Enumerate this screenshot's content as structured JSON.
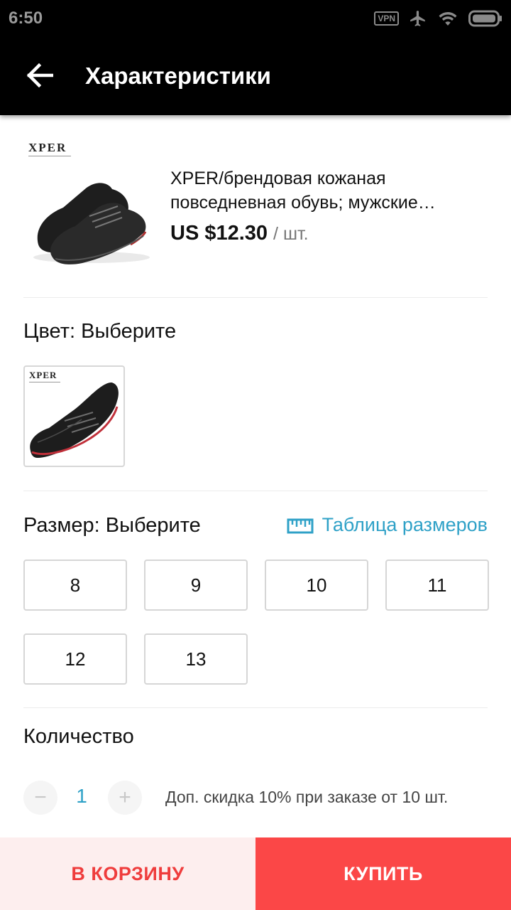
{
  "status_bar": {
    "time": "6:50",
    "vpn_label": "VPN",
    "icons": [
      "vpn-icon",
      "airplane-icon",
      "wifi-icon",
      "battery-icon"
    ]
  },
  "app_bar": {
    "title": "Характеристики",
    "back_icon": "arrow-left-icon"
  },
  "product": {
    "brand_logo": "XPER",
    "title": "XPER/брендовая кожаная повседневная обувь; мужские мокасины",
    "price": "US $12.30",
    "unit": "/ шт."
  },
  "color": {
    "label": "Цвет: Выберите",
    "options": [
      {
        "logo": "XPER",
        "selected": false
      }
    ]
  },
  "size": {
    "label": "Размер: Выберите",
    "table_link": "Таблица размеров",
    "options": [
      "8",
      "9",
      "10",
      "11",
      "12",
      "13"
    ]
  },
  "quantity": {
    "label": "Количество",
    "minus": "−",
    "plus": "+",
    "value": "1",
    "discount_note": "Доп. скидка 10% при заказе от 10 шт."
  },
  "actions": {
    "add_to_cart": "В КОРЗИНУ",
    "buy": "КУПИТЬ"
  },
  "colors": {
    "accent": "#2fa1c7",
    "buy": "#fb4747",
    "cart_bg": "#fdeeee",
    "cart_text": "#ef3c3c"
  }
}
